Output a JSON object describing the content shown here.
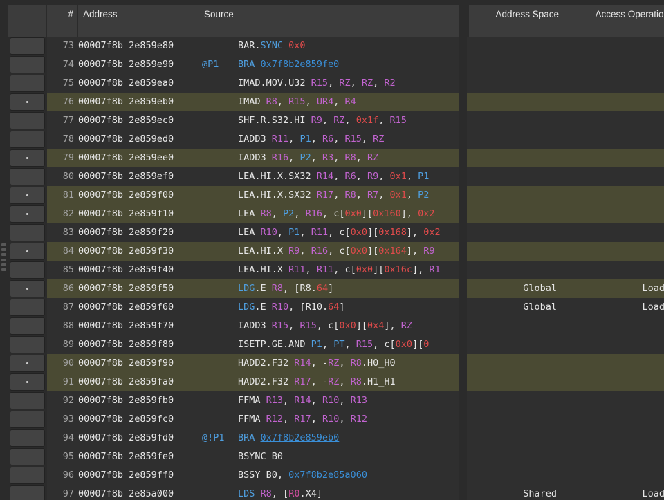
{
  "header": {
    "columns": [
      {
        "key": "gutter",
        "label": ""
      },
      {
        "key": "num",
        "label": "#"
      },
      {
        "key": "address",
        "label": "Address"
      },
      {
        "key": "source",
        "label": "Source"
      },
      {
        "key": "space",
        "label": "Address Space"
      },
      {
        "key": "op",
        "label": "Access Operation"
      }
    ]
  },
  "colors": {
    "background": "#2b2b2b",
    "row_normal": "#2f2f2f",
    "row_highlight": "#4a4a33",
    "header_bg": "#3c3c3c",
    "text": "#e6e6e6",
    "line_number": "#a3a3a3",
    "register": "#c264d0",
    "predicate": "#4f9fe0",
    "immediate": "#e04b4b",
    "link": "#3a8fd8",
    "mnemonic_accent": "#4f9fe0"
  },
  "rows": [
    {
      "marker": false,
      "highlight": false,
      "num": "73",
      "address": "00007f8b 2e859e80",
      "pred": "",
      "source_plain": "BAR.SYNC 0x0",
      "space": "",
      "op": ""
    },
    {
      "marker": false,
      "highlight": false,
      "num": "74",
      "address": "00007f8b 2e859e90",
      "pred": "@P1",
      "source_plain": "BRA 0x7f8b2e859fe0",
      "space": "",
      "op": ""
    },
    {
      "marker": false,
      "highlight": false,
      "num": "75",
      "address": "00007f8b 2e859ea0",
      "pred": "",
      "source_plain": "IMAD.MOV.U32 R15, RZ, RZ, R2",
      "space": "",
      "op": ""
    },
    {
      "marker": true,
      "highlight": true,
      "num": "76",
      "address": "00007f8b 2e859eb0",
      "pred": "",
      "source_plain": "IMAD R8, R15, UR4, R4",
      "space": "",
      "op": ""
    },
    {
      "marker": false,
      "highlight": false,
      "num": "77",
      "address": "00007f8b 2e859ec0",
      "pred": "",
      "source_plain": "SHF.R.S32.HI R9, RZ, 0x1f, R15",
      "space": "",
      "op": ""
    },
    {
      "marker": false,
      "highlight": false,
      "num": "78",
      "address": "00007f8b 2e859ed0",
      "pred": "",
      "source_plain": "IADD3 R11, P1, R6, R15, RZ",
      "space": "",
      "op": ""
    },
    {
      "marker": true,
      "highlight": true,
      "num": "79",
      "address": "00007f8b 2e859ee0",
      "pred": "",
      "source_plain": "IADD3 R16, P2, R3, R8, RZ",
      "space": "",
      "op": ""
    },
    {
      "marker": false,
      "highlight": false,
      "num": "80",
      "address": "00007f8b 2e859ef0",
      "pred": "",
      "source_plain": "LEA.HI.X.SX32 R14, R6, R9, 0x1, P1",
      "space": "",
      "op": ""
    },
    {
      "marker": true,
      "highlight": true,
      "num": "81",
      "address": "00007f8b 2e859f00",
      "pred": "",
      "source_plain": "LEA.HI.X.SX32 R17, R8, R7, 0x1, P2",
      "space": "",
      "op": ""
    },
    {
      "marker": true,
      "highlight": true,
      "num": "82",
      "address": "00007f8b 2e859f10",
      "pred": "",
      "source_plain": "LEA R8, P2, R16, c[0x0][0x160], 0x2",
      "space": "",
      "op": ""
    },
    {
      "marker": false,
      "highlight": false,
      "num": "83",
      "address": "00007f8b 2e859f20",
      "pred": "",
      "source_plain": "LEA R10, P1, R11, c[0x0][0x168], 0x2",
      "space": "",
      "op": ""
    },
    {
      "marker": true,
      "highlight": true,
      "num": "84",
      "address": "00007f8b 2e859f30",
      "pred": "",
      "source_plain": "LEA.HI.X R9, R16, c[0x0][0x164], R9",
      "space": "",
      "op": ""
    },
    {
      "marker": false,
      "highlight": false,
      "num": "85",
      "address": "00007f8b 2e859f40",
      "pred": "",
      "source_plain": "LEA.HI.X R11, R11, c[0x0][0x16c], R1",
      "space": "",
      "op": ""
    },
    {
      "marker": true,
      "highlight": true,
      "num": "86",
      "address": "00007f8b 2e859f50",
      "pred": "",
      "source_plain": "LDG.E R8, [R8.64]",
      "space": "Global",
      "op": "Load"
    },
    {
      "marker": false,
      "highlight": false,
      "num": "87",
      "address": "00007f8b 2e859f60",
      "pred": "",
      "source_plain": "LDG.E R10, [R10.64]",
      "space": "Global",
      "op": "Load"
    },
    {
      "marker": false,
      "highlight": false,
      "num": "88",
      "address": "00007f8b 2e859f70",
      "pred": "",
      "source_plain": "IADD3 R15, R15, c[0x0][0x4], RZ",
      "space": "",
      "op": ""
    },
    {
      "marker": false,
      "highlight": false,
      "num": "89",
      "address": "00007f8b 2e859f80",
      "pred": "",
      "source_plain": "ISETP.GE.AND P1, PT, R15, c[0x0][0x0",
      "space": "",
      "op": ""
    },
    {
      "marker": true,
      "highlight": true,
      "num": "90",
      "address": "00007f8b 2e859f90",
      "pred": "",
      "source_plain": "HADD2.F32 R14, -RZ, R8.H0_H0",
      "space": "",
      "op": ""
    },
    {
      "marker": true,
      "highlight": true,
      "num": "91",
      "address": "00007f8b 2e859fa0",
      "pred": "",
      "source_plain": "HADD2.F32 R17, -RZ, R8.H1_H1",
      "space": "",
      "op": ""
    },
    {
      "marker": false,
      "highlight": false,
      "num": "92",
      "address": "00007f8b 2e859fb0",
      "pred": "",
      "source_plain": "FFMA R13, R14, R10, R13",
      "space": "",
      "op": ""
    },
    {
      "marker": false,
      "highlight": false,
      "num": "93",
      "address": "00007f8b 2e859fc0",
      "pred": "",
      "source_plain": "FFMA R12, R17, R10, R12",
      "space": "",
      "op": ""
    },
    {
      "marker": false,
      "highlight": false,
      "num": "94",
      "address": "00007f8b 2e859fd0",
      "pred": "@!P1",
      "source_plain": "BRA 0x7f8b2e859eb0",
      "space": "",
      "op": ""
    },
    {
      "marker": false,
      "highlight": false,
      "num": "95",
      "address": "00007f8b 2e859fe0",
      "pred": "",
      "source_plain": "BSYNC B0",
      "space": "",
      "op": ""
    },
    {
      "marker": false,
      "highlight": false,
      "num": "96",
      "address": "00007f8b 2e859ff0",
      "pred": "",
      "source_plain": "BSSY B0, 0x7f8b2e85a060",
      "space": "",
      "op": ""
    },
    {
      "marker": false,
      "highlight": false,
      "num": "97",
      "address": "00007f8b 2e85a000",
      "pred": "",
      "source_plain": "LDS R8, [R0.X4]",
      "space": "Shared",
      "op": "Load"
    }
  ],
  "source_tokens": [
    [
      {
        "t": "BAR.",
        "c": "op"
      },
      {
        "t": "SYNC",
        "c": "mod"
      },
      {
        "t": " ",
        "c": "op"
      },
      {
        "t": "0x0",
        "c": "imm"
      }
    ],
    [
      {
        "t": "BRA ",
        "c": "mod"
      },
      {
        "t": "0x7f8b2e859fe0",
        "c": "link"
      }
    ],
    [
      {
        "t": "IMAD.MOV.U32 ",
        "c": "op"
      },
      {
        "t": "R15",
        "c": "reg"
      },
      {
        "t": ", ",
        "c": "op"
      },
      {
        "t": "RZ",
        "c": "reg"
      },
      {
        "t": ", ",
        "c": "op"
      },
      {
        "t": "RZ",
        "c": "reg"
      },
      {
        "t": ", ",
        "c": "op"
      },
      {
        "t": "R2",
        "c": "reg"
      }
    ],
    [
      {
        "t": "IMAD ",
        "c": "op"
      },
      {
        "t": "R8",
        "c": "reg"
      },
      {
        "t": ", ",
        "c": "op"
      },
      {
        "t": "R15",
        "c": "reg"
      },
      {
        "t": ", ",
        "c": "op"
      },
      {
        "t": "UR4",
        "c": "reg"
      },
      {
        "t": ", ",
        "c": "op"
      },
      {
        "t": "R4",
        "c": "reg"
      }
    ],
    [
      {
        "t": "SHF.R.S32.HI ",
        "c": "op"
      },
      {
        "t": "R9",
        "c": "reg"
      },
      {
        "t": ", ",
        "c": "op"
      },
      {
        "t": "RZ",
        "c": "reg"
      },
      {
        "t": ", ",
        "c": "op"
      },
      {
        "t": "0x1f",
        "c": "imm"
      },
      {
        "t": ", ",
        "c": "op"
      },
      {
        "t": "R15",
        "c": "reg"
      }
    ],
    [
      {
        "t": "IADD3 ",
        "c": "op"
      },
      {
        "t": "R11",
        "c": "reg"
      },
      {
        "t": ", ",
        "c": "op"
      },
      {
        "t": "P1",
        "c": "pred"
      },
      {
        "t": ", ",
        "c": "op"
      },
      {
        "t": "R6",
        "c": "reg"
      },
      {
        "t": ", ",
        "c": "op"
      },
      {
        "t": "R15",
        "c": "reg"
      },
      {
        "t": ", ",
        "c": "op"
      },
      {
        "t": "RZ",
        "c": "reg"
      }
    ],
    [
      {
        "t": "IADD3 ",
        "c": "op"
      },
      {
        "t": "R16",
        "c": "reg"
      },
      {
        "t": ", ",
        "c": "op"
      },
      {
        "t": "P2",
        "c": "pred"
      },
      {
        "t": ", ",
        "c": "op"
      },
      {
        "t": "R3",
        "c": "reg"
      },
      {
        "t": ", ",
        "c": "op"
      },
      {
        "t": "R8",
        "c": "reg"
      },
      {
        "t": ", ",
        "c": "op"
      },
      {
        "t": "RZ",
        "c": "reg"
      }
    ],
    [
      {
        "t": "LEA.HI.X.SX32 ",
        "c": "op"
      },
      {
        "t": "R14",
        "c": "reg"
      },
      {
        "t": ", ",
        "c": "op"
      },
      {
        "t": "R6",
        "c": "reg"
      },
      {
        "t": ", ",
        "c": "op"
      },
      {
        "t": "R9",
        "c": "reg"
      },
      {
        "t": ", ",
        "c": "op"
      },
      {
        "t": "0x1",
        "c": "imm"
      },
      {
        "t": ", ",
        "c": "op"
      },
      {
        "t": "P1",
        "c": "pred"
      }
    ],
    [
      {
        "t": "LEA.HI.X.SX32 ",
        "c": "op"
      },
      {
        "t": "R17",
        "c": "reg"
      },
      {
        "t": ", ",
        "c": "op"
      },
      {
        "t": "R8",
        "c": "reg"
      },
      {
        "t": ", ",
        "c": "op"
      },
      {
        "t": "R7",
        "c": "reg"
      },
      {
        "t": ", ",
        "c": "op"
      },
      {
        "t": "0x1",
        "c": "imm"
      },
      {
        "t": ", ",
        "c": "op"
      },
      {
        "t": "P2",
        "c": "pred"
      }
    ],
    [
      {
        "t": "LEA ",
        "c": "op"
      },
      {
        "t": "R8",
        "c": "reg"
      },
      {
        "t": ", ",
        "c": "op"
      },
      {
        "t": "P2",
        "c": "pred"
      },
      {
        "t": ", ",
        "c": "op"
      },
      {
        "t": "R16",
        "c": "reg"
      },
      {
        "t": ", c[",
        "c": "op"
      },
      {
        "t": "0x0",
        "c": "imm"
      },
      {
        "t": "][",
        "c": "op"
      },
      {
        "t": "0x160",
        "c": "imm"
      },
      {
        "t": "], ",
        "c": "op"
      },
      {
        "t": "0x2",
        "c": "imm"
      }
    ],
    [
      {
        "t": "LEA ",
        "c": "op"
      },
      {
        "t": "R10",
        "c": "reg"
      },
      {
        "t": ", ",
        "c": "op"
      },
      {
        "t": "P1",
        "c": "pred"
      },
      {
        "t": ", ",
        "c": "op"
      },
      {
        "t": "R11",
        "c": "reg"
      },
      {
        "t": ", c[",
        "c": "op"
      },
      {
        "t": "0x0",
        "c": "imm"
      },
      {
        "t": "][",
        "c": "op"
      },
      {
        "t": "0x168",
        "c": "imm"
      },
      {
        "t": "], ",
        "c": "op"
      },
      {
        "t": "0x2",
        "c": "imm"
      }
    ],
    [
      {
        "t": "LEA.HI.X ",
        "c": "op"
      },
      {
        "t": "R9",
        "c": "reg"
      },
      {
        "t": ", ",
        "c": "op"
      },
      {
        "t": "R16",
        "c": "reg"
      },
      {
        "t": ", c[",
        "c": "op"
      },
      {
        "t": "0x0",
        "c": "imm"
      },
      {
        "t": "][",
        "c": "op"
      },
      {
        "t": "0x164",
        "c": "imm"
      },
      {
        "t": "], ",
        "c": "op"
      },
      {
        "t": "R9",
        "c": "reg"
      }
    ],
    [
      {
        "t": "LEA.HI.X ",
        "c": "op"
      },
      {
        "t": "R11",
        "c": "reg"
      },
      {
        "t": ", ",
        "c": "op"
      },
      {
        "t": "R11",
        "c": "reg"
      },
      {
        "t": ", c[",
        "c": "op"
      },
      {
        "t": "0x0",
        "c": "imm"
      },
      {
        "t": "][",
        "c": "op"
      },
      {
        "t": "0x16c",
        "c": "imm"
      },
      {
        "t": "], ",
        "c": "op"
      },
      {
        "t": "R1",
        "c": "reg"
      }
    ],
    [
      {
        "t": "LDG",
        "c": "mod"
      },
      {
        "t": ".E ",
        "c": "op"
      },
      {
        "t": "R8",
        "c": "reg"
      },
      {
        "t": ", [",
        "c": "op"
      },
      {
        "t": "R8",
        "c": "op"
      },
      {
        "t": ".",
        "c": "op"
      },
      {
        "t": "64",
        "c": "imm"
      },
      {
        "t": "]",
        "c": "op"
      }
    ],
    [
      {
        "t": "LDG",
        "c": "mod"
      },
      {
        "t": ".E ",
        "c": "op"
      },
      {
        "t": "R10",
        "c": "reg"
      },
      {
        "t": ", [",
        "c": "op"
      },
      {
        "t": "R10",
        "c": "op"
      },
      {
        "t": ".",
        "c": "op"
      },
      {
        "t": "64",
        "c": "imm"
      },
      {
        "t": "]",
        "c": "op"
      }
    ],
    [
      {
        "t": "IADD3 ",
        "c": "op"
      },
      {
        "t": "R15",
        "c": "reg"
      },
      {
        "t": ", ",
        "c": "op"
      },
      {
        "t": "R15",
        "c": "reg"
      },
      {
        "t": ", c[",
        "c": "op"
      },
      {
        "t": "0x0",
        "c": "imm"
      },
      {
        "t": "][",
        "c": "op"
      },
      {
        "t": "0x4",
        "c": "imm"
      },
      {
        "t": "], ",
        "c": "op"
      },
      {
        "t": "RZ",
        "c": "reg"
      }
    ],
    [
      {
        "t": "ISETP.GE.AND ",
        "c": "op"
      },
      {
        "t": "P1",
        "c": "pred"
      },
      {
        "t": ", ",
        "c": "op"
      },
      {
        "t": "PT",
        "c": "pred"
      },
      {
        "t": ", ",
        "c": "op"
      },
      {
        "t": "R15",
        "c": "reg"
      },
      {
        "t": ", c[",
        "c": "op"
      },
      {
        "t": "0x0",
        "c": "imm"
      },
      {
        "t": "][",
        "c": "op"
      },
      {
        "t": "0",
        "c": "imm"
      }
    ],
    [
      {
        "t": "HADD2.F32 ",
        "c": "op"
      },
      {
        "t": "R14",
        "c": "reg"
      },
      {
        "t": ", -",
        "c": "op"
      },
      {
        "t": "RZ",
        "c": "reg"
      },
      {
        "t": ", ",
        "c": "op"
      },
      {
        "t": "R8",
        "c": "reg"
      },
      {
        "t": ".H0_H0",
        "c": "op"
      }
    ],
    [
      {
        "t": "HADD2.F32 ",
        "c": "op"
      },
      {
        "t": "R17",
        "c": "reg"
      },
      {
        "t": ", -",
        "c": "op"
      },
      {
        "t": "RZ",
        "c": "reg"
      },
      {
        "t": ", ",
        "c": "op"
      },
      {
        "t": "R8",
        "c": "reg"
      },
      {
        "t": ".H1_H1",
        "c": "op"
      }
    ],
    [
      {
        "t": "FFMA ",
        "c": "op"
      },
      {
        "t": "R13",
        "c": "reg"
      },
      {
        "t": ", ",
        "c": "op"
      },
      {
        "t": "R14",
        "c": "reg"
      },
      {
        "t": ", ",
        "c": "op"
      },
      {
        "t": "R10",
        "c": "reg"
      },
      {
        "t": ", ",
        "c": "op"
      },
      {
        "t": "R13",
        "c": "reg"
      }
    ],
    [
      {
        "t": "FFMA ",
        "c": "op"
      },
      {
        "t": "R12",
        "c": "reg"
      },
      {
        "t": ", ",
        "c": "op"
      },
      {
        "t": "R17",
        "c": "reg"
      },
      {
        "t": ", ",
        "c": "op"
      },
      {
        "t": "R10",
        "c": "reg"
      },
      {
        "t": ", ",
        "c": "op"
      },
      {
        "t": "R12",
        "c": "reg"
      }
    ],
    [
      {
        "t": "BRA ",
        "c": "mod"
      },
      {
        "t": "0x7f8b2e859eb0",
        "c": "link"
      }
    ],
    [
      {
        "t": "BSYNC B0",
        "c": "op"
      }
    ],
    [
      {
        "t": "BSSY B0, ",
        "c": "op"
      },
      {
        "t": "0x7f8b2e85a060",
        "c": "link"
      }
    ],
    [
      {
        "t": "LDS",
        "c": "mod"
      },
      {
        "t": " ",
        "c": "op"
      },
      {
        "t": "R8",
        "c": "reg"
      },
      {
        "t": ", [",
        "c": "op"
      },
      {
        "t": "R0",
        "c": "pnk"
      },
      {
        "t": ".X4]",
        "c": "op"
      }
    ]
  ]
}
